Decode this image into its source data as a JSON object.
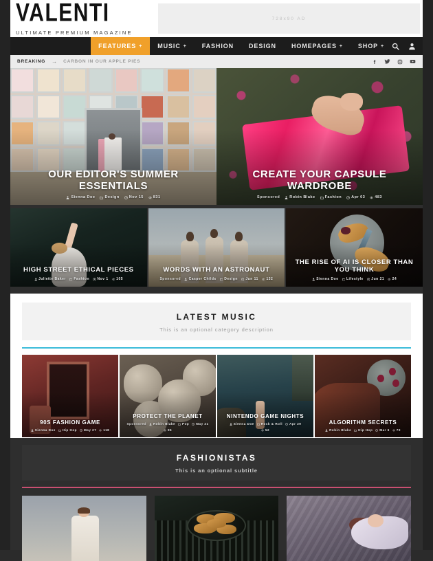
{
  "site": {
    "logo_title": "VALENTI",
    "logo_subtitle": "ULTIMATE PREMIUM MAGAZINE",
    "ad_label": "728x90 AD",
    "accent_orange": "#f0a02a",
    "accent_cyan": "#3bbcd9",
    "accent_pink": "#c94f71"
  },
  "nav": {
    "items": [
      {
        "label": "FEATURES",
        "has_dropdown": true,
        "active": true
      },
      {
        "label": "MUSIC",
        "has_dropdown": true,
        "active": false
      },
      {
        "label": "FASHION",
        "has_dropdown": false,
        "active": false
      },
      {
        "label": "DESIGN",
        "has_dropdown": false,
        "active": false
      },
      {
        "label": "HOMEPAGES",
        "has_dropdown": true,
        "active": false
      },
      {
        "label": "SHOP",
        "has_dropdown": true,
        "active": false
      }
    ],
    "caret": "+",
    "icons": [
      "search-icon",
      "user-icon"
    ]
  },
  "breaking": {
    "label": "BREAKING",
    "arrow": "→",
    "headline": "CARBON IN OUR APPLE PIES",
    "social": [
      "facebook-icon",
      "twitter-icon",
      "instagram-icon",
      "youtube-icon"
    ]
  },
  "hero": [
    {
      "title": "OUR EDITOR'S SUMMER ESSENTIALS",
      "sponsored": "",
      "author": "Sienna Doe",
      "category": "Design",
      "date": "Nov 15",
      "views": "831"
    },
    {
      "title": "CREATE YOUR CAPSULE WARDROBE",
      "sponsored": "Sponsored",
      "author": "Robin Blake",
      "category": "Fashion",
      "date": "Apr 03",
      "views": "483"
    }
  ],
  "secondary": [
    {
      "title": "HIGH STREET ETHICAL PIECES",
      "sponsored": "",
      "author": "Juliette Baker",
      "category": "Fashion",
      "date": "Nov 1",
      "views": "105"
    },
    {
      "title": "WORDS WITH AN ASTRONAUT",
      "sponsored": "Sponsored",
      "author": "Casper Childs",
      "category": "Design",
      "date": "Jun 11",
      "views": "132"
    },
    {
      "title": "THE RISE OF AI IS CLOSER THAN YOU THINK",
      "sponsored": "",
      "author": "Sienna Doe",
      "category": "Lifestyle",
      "date": "Jun 21",
      "views": "24"
    }
  ],
  "music_section": {
    "title": "LATEST MUSIC",
    "subtitle": "This is an optional category description",
    "cards": [
      {
        "title": "90S FASHION GAME",
        "sponsored": "",
        "author": "Sienna Doe",
        "category": "Hip Hop",
        "date": "May 27",
        "views": "118"
      },
      {
        "title": "PROTECT THE PLANET",
        "sponsored": "Sponsored",
        "author": "Robin Blake",
        "category": "Pop",
        "date": "May 21",
        "views": "96"
      },
      {
        "title": "NINTENDO GAME NIGHTS",
        "sponsored": "",
        "author": "Sienna Doe",
        "category": "Rock & Roll",
        "date": "Apr 29",
        "views": "52"
      },
      {
        "title": "ALGORITHM SECRETS",
        "sponsored": "",
        "author": "Robin Blake",
        "category": "Hip Hop",
        "date": "Mar 6",
        "views": "70"
      }
    ]
  },
  "fashion_section": {
    "title": "FASHIONISTAS",
    "subtitle": "This is an optional subtitle",
    "cards": [
      {
        "alt": "woman-in-floral-dress"
      },
      {
        "alt": "grilled-chicken-on-pan"
      },
      {
        "alt": "woman-floating-in-water"
      }
    ]
  }
}
